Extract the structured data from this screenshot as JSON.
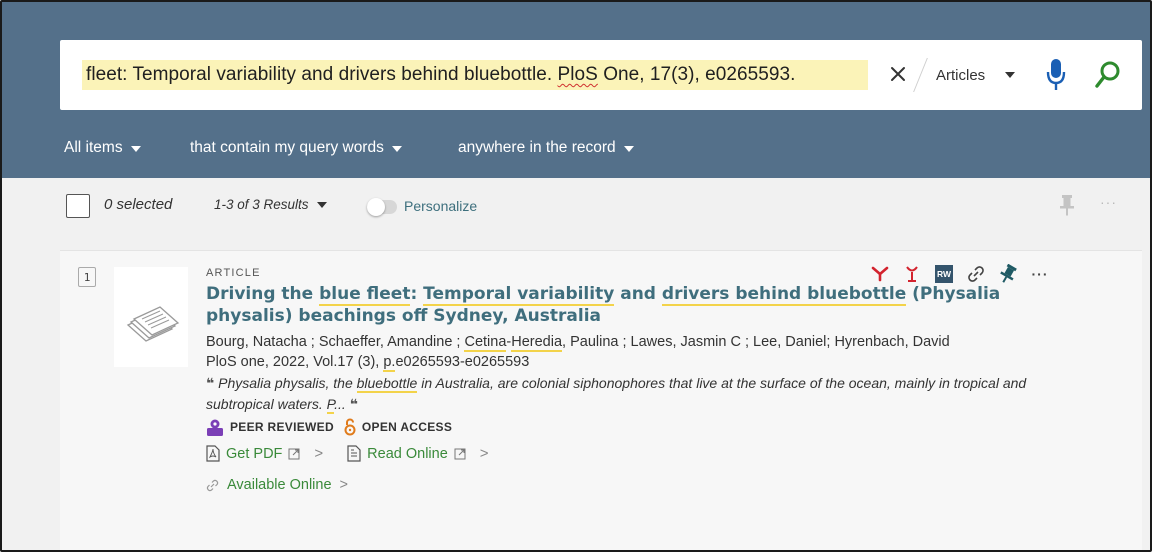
{
  "search": {
    "query_prefix": "fleet: Temporal variability and drivers behind bluebottle. ",
    "query_misspelled": "PloS",
    "query_suffix": " One, 17(3), e0265593.",
    "scope": "Articles"
  },
  "filters": {
    "items": "All items",
    "contains": "that contain my query words",
    "where": "anywhere in the record"
  },
  "toolbar": {
    "selected": "0 selected",
    "results": "1-3 of 3 Results",
    "personalize": "Personalize",
    "more": "···"
  },
  "result": {
    "index": "1",
    "type": "ARTICLE",
    "title": {
      "t1": "Driving the ",
      "t2": "blue fleet",
      "t3": ": ",
      "t4": "Temporal variability",
      "t5": " and ",
      "t6": "drivers behind bluebottle",
      "t7": " (Physalia physalis) beachings off Sydney, Australia"
    },
    "authors": {
      "a1": "Bourg, Natacha ; Schaeffer, Amandine ; ",
      "a2": "Cetina",
      "a3": "-",
      "a4": "Heredia",
      "a5": ", Paulina ; Lawes, Jasmin C ; Lee, Daniel; Hyrenbach, David"
    },
    "source": {
      "s1": "PloS one, 2022, Vol.17 (3), ",
      "s2": "p.",
      "s3": "e0265593-e0265593"
    },
    "snippet": {
      "quote_open": "❝",
      "p1": " Physalia physalis, the ",
      "p2": "bluebottle",
      "p3": " in Australia, are colonial siphonophores that live at the surface of the ocean, mainly in tropical and subtropical waters. ",
      "p4": "P",
      "p5": "...",
      "quote_close": " ❝"
    },
    "badges": {
      "peer": "PEER REVIEWED",
      "open": "OPEN ACCESS"
    },
    "links": {
      "pdf": "Get PDF",
      "online": "Read Online",
      "available": "Available Online",
      "chevron": ">"
    },
    "actions": {
      "rw": "RW",
      "more": "···"
    }
  },
  "colors": {
    "header": "#54708a",
    "title": "#3f6e7d",
    "link_green": "#3a8a3a",
    "highlight": "#f3d34a",
    "peer_purple": "#7b3fb6",
    "open_orange": "#e07b1b",
    "action_red": "#d3232e"
  }
}
